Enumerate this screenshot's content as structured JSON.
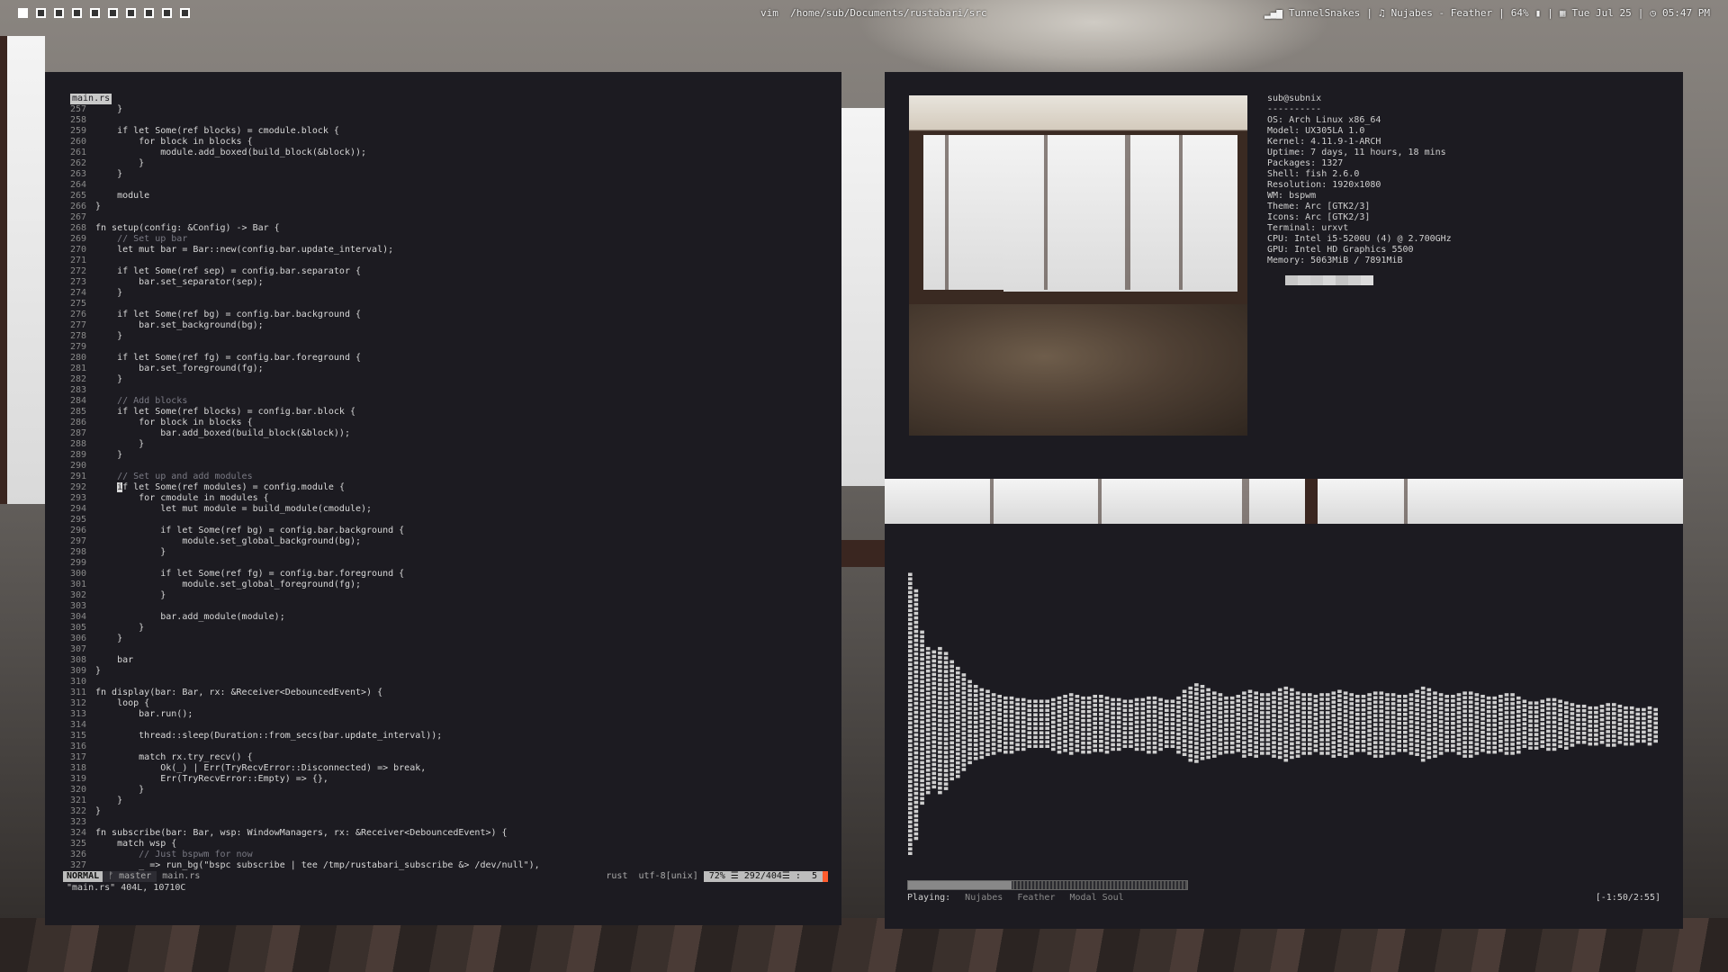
{
  "topbar": {
    "workspaces": [
      {
        "active": true
      },
      {
        "active": false
      },
      {
        "active": false
      },
      {
        "active": false
      },
      {
        "active": false
      },
      {
        "active": false
      },
      {
        "active": false
      },
      {
        "active": false
      },
      {
        "active": false
      },
      {
        "active": false
      }
    ],
    "title": "vim  /home/sub/Documents/rustabari/src",
    "wifi": "TunnelSnakes",
    "music": "Nujabes - Feather",
    "battery": "64%",
    "date": "Tue Jul 25",
    "time": "05:47 PM",
    "sep": "|"
  },
  "vim": {
    "filetab": "main.rs",
    "lines": [
      {
        "n": "257",
        "t": "    }"
      },
      {
        "n": "258",
        "t": ""
      },
      {
        "n": "259",
        "t": "    if let Some(ref blocks) = cmodule.block {"
      },
      {
        "n": "260",
        "t": "        for block in blocks {"
      },
      {
        "n": "261",
        "t": "            module.add_boxed(build_block(&block));"
      },
      {
        "n": "262",
        "t": "        }"
      },
      {
        "n": "263",
        "t": "    }"
      },
      {
        "n": "264",
        "t": ""
      },
      {
        "n": "265",
        "t": "    module"
      },
      {
        "n": "266",
        "t": "}"
      },
      {
        "n": "267",
        "t": ""
      },
      {
        "n": "268",
        "t": "fn setup(config: &Config) -> Bar {"
      },
      {
        "n": "269",
        "t": "    // Set up bar",
        "c": true
      },
      {
        "n": "270",
        "t": "    let mut bar = Bar::new(config.bar.update_interval);"
      },
      {
        "n": "271",
        "t": ""
      },
      {
        "n": "272",
        "t": "    if let Some(ref sep) = config.bar.separator {"
      },
      {
        "n": "273",
        "t": "        bar.set_separator(sep);"
      },
      {
        "n": "274",
        "t": "    }"
      },
      {
        "n": "275",
        "t": ""
      },
      {
        "n": "276",
        "t": "    if let Some(ref bg) = config.bar.background {"
      },
      {
        "n": "277",
        "t": "        bar.set_background(bg);"
      },
      {
        "n": "278",
        "t": "    }"
      },
      {
        "n": "279",
        "t": ""
      },
      {
        "n": "280",
        "t": "    if let Some(ref fg) = config.bar.foreground {"
      },
      {
        "n": "281",
        "t": "        bar.set_foreground(fg);"
      },
      {
        "n": "282",
        "t": "    }"
      },
      {
        "n": "283",
        "t": ""
      },
      {
        "n": "284",
        "t": "    // Add blocks",
        "c": true
      },
      {
        "n": "285",
        "t": "    if let Some(ref blocks) = config.bar.block {"
      },
      {
        "n": "286",
        "t": "        for block in blocks {"
      },
      {
        "n": "287",
        "t": "            bar.add_boxed(build_block(&block));"
      },
      {
        "n": "288",
        "t": "        }"
      },
      {
        "n": "289",
        "t": "    }"
      },
      {
        "n": "290",
        "t": ""
      },
      {
        "n": "291",
        "t": "    // Set up and add modules",
        "c": true
      },
      {
        "n": "292",
        "t": "    if let Some(ref modules) = config.module {",
        "cursor": true
      },
      {
        "n": "293",
        "t": "        for cmodule in modules {"
      },
      {
        "n": "294",
        "t": "            let mut module = build_module(cmodule);"
      },
      {
        "n": "295",
        "t": ""
      },
      {
        "n": "296",
        "t": "            if let Some(ref bg) = config.bar.background {"
      },
      {
        "n": "297",
        "t": "                module.set_global_background(bg);"
      },
      {
        "n": "298",
        "t": "            }"
      },
      {
        "n": "299",
        "t": ""
      },
      {
        "n": "300",
        "t": "            if let Some(ref fg) = config.bar.foreground {"
      },
      {
        "n": "301",
        "t": "                module.set_global_foreground(fg);"
      },
      {
        "n": "302",
        "t": "            }"
      },
      {
        "n": "303",
        "t": ""
      },
      {
        "n": "304",
        "t": "            bar.add_module(module);"
      },
      {
        "n": "305",
        "t": "        }"
      },
      {
        "n": "306",
        "t": "    }"
      },
      {
        "n": "307",
        "t": ""
      },
      {
        "n": "308",
        "t": "    bar"
      },
      {
        "n": "309",
        "t": "}"
      },
      {
        "n": "310",
        "t": ""
      },
      {
        "n": "311",
        "t": "fn display(bar: Bar, rx: &Receiver<DebouncedEvent>) {"
      },
      {
        "n": "312",
        "t": "    loop {"
      },
      {
        "n": "313",
        "t": "        bar.run();"
      },
      {
        "n": "314",
        "t": ""
      },
      {
        "n": "315",
        "t": "        thread::sleep(Duration::from_secs(bar.update_interval));"
      },
      {
        "n": "316",
        "t": ""
      },
      {
        "n": "317",
        "t": "        match rx.try_recv() {"
      },
      {
        "n": "318",
        "t": "            Ok(_) | Err(TryRecvError::Disconnected) => break,"
      },
      {
        "n": "319",
        "t": "            Err(TryRecvError::Empty) => {},"
      },
      {
        "n": "320",
        "t": "        }"
      },
      {
        "n": "321",
        "t": "    }"
      },
      {
        "n": "322",
        "t": "}"
      },
      {
        "n": "323",
        "t": ""
      },
      {
        "n": "324",
        "t": "fn subscribe(bar: Bar, wsp: WindowManagers, rx: &Receiver<DebouncedEvent>) {"
      },
      {
        "n": "325",
        "t": "    match wsp {"
      },
      {
        "n": "326",
        "t": "        // Just bspwm for now",
        "c": true
      },
      {
        "n": "327",
        "t": "        _ => run_bg(\"bspc subscribe | tee /tmp/rustabari_subscribe &> /dev/null\"),"
      }
    ],
    "statusline": {
      "mode": "NORMAL",
      "branch": "ᚠ master",
      "file": "main.rs",
      "filetype": "rust",
      "encoding": "utf-8[unix]",
      "position": "72% ☰ 292/404☰ :  5"
    },
    "cmdline": "\"main.rs\" 404L, 10710C"
  },
  "neofetch": {
    "info": [
      "sub@subnix",
      "----------",
      "OS: Arch Linux x86_64",
      "Model: UX305LA 1.0",
      "Kernel: 4.11.9-1-ARCH",
      "Uptime: 7 days, 11 hours, 18 mins",
      "Packages: 1327",
      "Shell: fish 2.6.0",
      "Resolution: 1920x1080",
      "WM: bspwm",
      "Theme: Arc [GTK2/3]",
      "Icons: Arc [GTK2/3]",
      "Terminal: urxvt",
      "CPU: Intel i5-5200U (4) @ 2.700GHz",
      "GPU: Intel HD Graphics 5500",
      "Memory: 5063MiB / 7891MiB"
    ],
    "palette": [
      "#c8c8c8",
      "#d4d4d4",
      "#cccccc",
      "#d8d8d8",
      "#c4c4c4",
      "#d0d0d0",
      "#dcdcdc"
    ]
  },
  "visualizer": {
    "levels": [
      0.95,
      0.85,
      0.6,
      0.5,
      0.48,
      0.5,
      0.47,
      0.42,
      0.38,
      0.34,
      0.3,
      0.27,
      0.25,
      0.24,
      0.22,
      0.21,
      0.2,
      0.2,
      0.19,
      0.19,
      0.18,
      0.18,
      0.18,
      0.18,
      0.19,
      0.2,
      0.21,
      0.22,
      0.21,
      0.2,
      0.2,
      0.21,
      0.21,
      0.2,
      0.19,
      0.19,
      0.18,
      0.18,
      0.19,
      0.19,
      0.2,
      0.2,
      0.19,
      0.18,
      0.18,
      0.2,
      0.24,
      0.26,
      0.28,
      0.27,
      0.25,
      0.23,
      0.22,
      0.2,
      0.2,
      0.21,
      0.23,
      0.24,
      0.23,
      0.22,
      0.22,
      0.23,
      0.25,
      0.26,
      0.25,
      0.23,
      0.22,
      0.22,
      0.21,
      0.22,
      0.22,
      0.23,
      0.24,
      0.23,
      0.22,
      0.21,
      0.21,
      0.22,
      0.23,
      0.23,
      0.22,
      0.22,
      0.21,
      0.21,
      0.22,
      0.24,
      0.26,
      0.25,
      0.23,
      0.22,
      0.21,
      0.21,
      0.22,
      0.23,
      0.23,
      0.22,
      0.21,
      0.2,
      0.2,
      0.21,
      0.22,
      0.22,
      0.2,
      0.18,
      0.17,
      0.17,
      0.18,
      0.19,
      0.19,
      0.18,
      0.17,
      0.16,
      0.15,
      0.15,
      0.14,
      0.14,
      0.15,
      0.16,
      0.16,
      0.15,
      0.14,
      0.14,
      0.13,
      0.13,
      0.14,
      0.13
    ],
    "progress": 0.37,
    "playing_label": "Playing:",
    "artist": "Nujabes",
    "track": "Feather",
    "album": "Modal Soul",
    "time": "[-1:50/2:55]"
  }
}
